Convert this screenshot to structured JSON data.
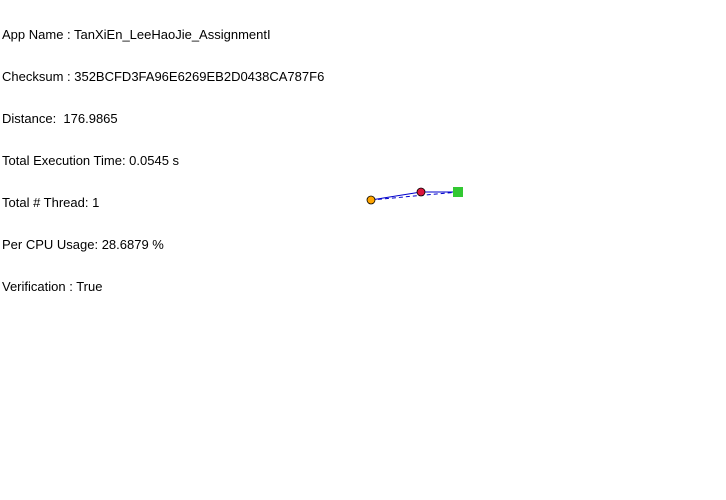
{
  "info": {
    "app_name": "App Name : TanXiEn_LeeHaoJie_AssignmentI",
    "checksum": "Checksum : 352BCFD3FA96E6269EB2D0438CA787F6",
    "distance": "Distance:  176.9865",
    "execution_time": "Total Execution Time: 0.0545 s",
    "thread_count": "Total # Thread: 1",
    "cpu_usage": "Per CPU Usage: 28.6879 %",
    "verification": "Verification : True"
  },
  "colors": {
    "start_node": "#ffa500",
    "mid_node": "#dc143c",
    "end_node": "#32c832",
    "path_line": "#0000cc",
    "node_outline": "#000000"
  }
}
